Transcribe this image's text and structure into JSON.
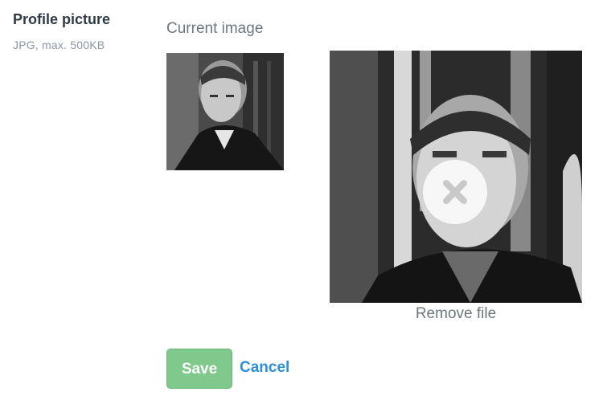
{
  "field": {
    "label": "Profile picture",
    "hint": "JPG, max. 500KB"
  },
  "current": {
    "label": "Current image"
  },
  "preview": {
    "remove_label": "Remove file",
    "remove_icon": "close-icon"
  },
  "actions": {
    "save_label": "Save",
    "cancel_label": "Cancel"
  },
  "colors": {
    "save_bg": "#7ec98b",
    "cancel_text": "#2f8fd8",
    "label_text": "#2f3a45",
    "hint_text": "#8a97a4"
  }
}
